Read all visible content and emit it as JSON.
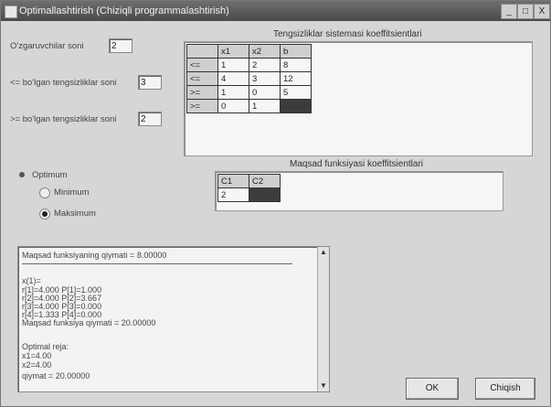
{
  "window": {
    "title": "Optimallashtirish (Chiziqli programmalashtirish)",
    "controls": {
      "minimize": "_",
      "maximize": "□",
      "close": "X"
    }
  },
  "inputs": {
    "vars_label": "O'zgaruvchilar soni",
    "vars_value": "2",
    "le_label": "<= bo'lgan tengsizliklar soni",
    "le_value": "3",
    "ge_label": ">= bo'lgan tengsizliklar soni",
    "ge_value": "2"
  },
  "constraints": {
    "title": "Tengsizliklar sistemasi koeffitsientlari",
    "header": [
      "",
      "x1",
      "x2",
      "b"
    ],
    "rows": [
      [
        "<=",
        "1",
        "2",
        "8"
      ],
      [
        "<=",
        "4",
        "3",
        "12"
      ],
      [
        ">=",
        "1",
        "0",
        "5"
      ],
      [
        ">=",
        "0",
        "1",
        ""
      ]
    ]
  },
  "objective": {
    "title": "Maqsad funksiyasi koeffitsientlari",
    "header": [
      "C1",
      "C2"
    ],
    "values": [
      "2",
      ""
    ]
  },
  "mode": {
    "label": "Optimum",
    "minimum": "Minimum",
    "maximum": "Maksimum",
    "selected": "maximum"
  },
  "result": {
    "lines": [
      "Maqsad funksiyaning qiymati = 8.00000",
      "",
      "x(1)=",
      "r[1]=4.000    P[1]=1.000",
      "r[2]=4.000    P[2]=3.667",
      "r[3]=4.000    P[3]=0.000",
      "r[4]=1.333    P[4]=0.000",
      "Maqsad funksiya qiymati = 20.00000",
      "",
      "Optimal reja:",
      "x1=4.00",
      "x2=4.00",
      "qiymat = 20.00000"
    ]
  },
  "buttons": {
    "ok": "OK",
    "clear": "Chiqish"
  }
}
